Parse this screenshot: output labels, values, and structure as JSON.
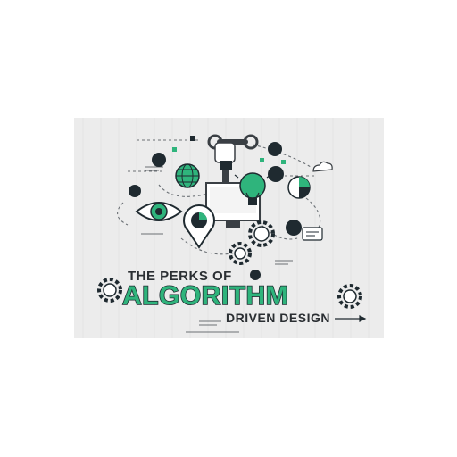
{
  "illustration": {
    "title_line_1": "THE PERKS OF",
    "title_line_2": "ALGORITHM",
    "title_line_3": "DRIVEN DESIGN",
    "icons": [
      "wrench-hand-icon",
      "globe-icon",
      "lightbulb-icon",
      "eye-icon",
      "location-pin-icon",
      "gear-icon",
      "cloud-icon",
      "pie-chart-icon",
      "monitor-icon",
      "chat-bubble-icon"
    ],
    "colors": {
      "background": "#ececec",
      "accent": "#2fb47c",
      "dark": "#1f2a30"
    }
  }
}
